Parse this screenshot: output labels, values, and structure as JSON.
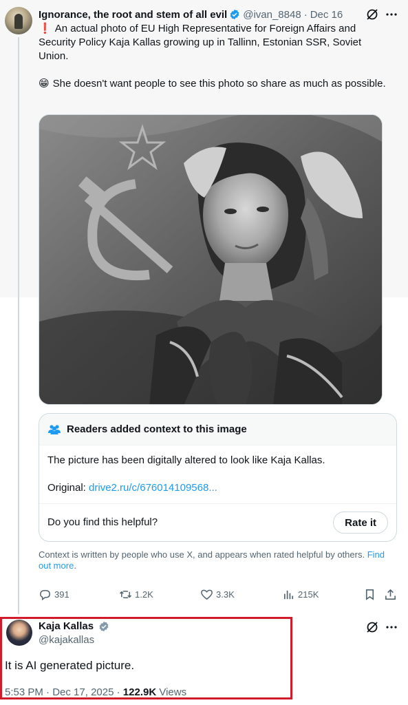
{
  "colors": {
    "accent": "#1d9bf0",
    "text_primary": "#0f1419",
    "text_secondary": "#536471",
    "border": "#cfd9de",
    "highlight_box": "#d11a2a"
  },
  "tweet": {
    "author_name": "Ignorance, the root and stem of all evil",
    "handle": "@ivan_8848",
    "separator": "·",
    "date": "Dec 16",
    "text_para1_emoji": "❗",
    "text_para1": "An actual photo of EU High Representative for Foreign Affairs and Security Policy Kaja Kallas growing up in Tallinn, Estonian SSR, Soviet Union.",
    "text_para2_emoji": "😁",
    "text_para2": "She doesn't want people to see this photo so share as much as possible.",
    "icons": {
      "grok": "grok-icon",
      "more": "more-icon",
      "verified": "verified-badge-icon"
    }
  },
  "community_note": {
    "title": "Readers added context to this image",
    "body": "The picture has been digitally altered to look like Kaja Kallas.",
    "original_label": "Original:",
    "original_link": "drive2.ru/c/676014109568...",
    "helpful_prompt": "Do you find this helpful?",
    "rate_button": "Rate it",
    "footer_text": "Context is written by people who use X, and appears when rated helpful by others.",
    "footer_link": "Find out more",
    "footer_period": "."
  },
  "actions": {
    "replies": "391",
    "reposts": "1.2K",
    "likes": "3.3K",
    "views": "215K"
  },
  "reply": {
    "author_name": "Kaja Kallas",
    "handle": "@kajakallas",
    "text": "It is AI generated picture.",
    "time": "5:53 PM",
    "separator": "·",
    "date": "Dec 17, 2025",
    "separator2": "·",
    "views_count": "122.9K",
    "views_label": "Views"
  }
}
